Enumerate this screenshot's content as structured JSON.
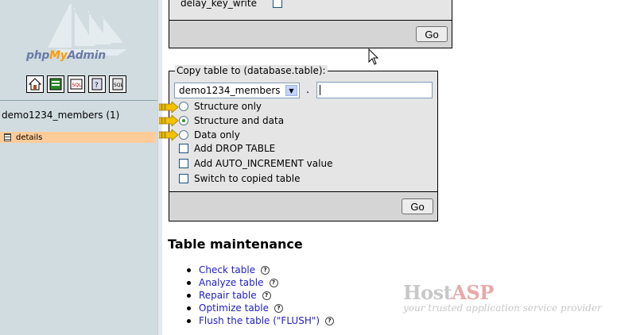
{
  "nav": {
    "logo": {
      "php": "php",
      "my": "My",
      "admin": "Admin"
    },
    "icons": [
      "home-icon",
      "query-window-icon",
      "sql-icon",
      "documentation-icon",
      "sql-docs-icon"
    ],
    "database_label": "demo1234_members (1)",
    "table_label": "details"
  },
  "top_section": {
    "checkbox_label": "delay_key_write",
    "checked": false,
    "go_label": "Go"
  },
  "copy_table": {
    "legend": "Copy table to (database.table):",
    "database_select": "demo1234_members",
    "separator": ".",
    "table_name_value": "",
    "options": [
      {
        "type": "radio",
        "label": "Structure only",
        "selected": false
      },
      {
        "type": "radio",
        "label": "Structure and data",
        "selected": true
      },
      {
        "type": "radio",
        "label": "Data only",
        "selected": false
      },
      {
        "type": "checkbox",
        "label": "Add DROP TABLE",
        "checked": false
      },
      {
        "type": "checkbox",
        "label": "Add AUTO_INCREMENT value",
        "checked": false
      },
      {
        "type": "checkbox",
        "label": "Switch to copied table",
        "checked": false
      }
    ],
    "go_label": "Go"
  },
  "maintenance": {
    "heading": "Table maintenance",
    "items": [
      {
        "label": "Check table"
      },
      {
        "label": "Analyze table"
      },
      {
        "label": "Repair table"
      },
      {
        "label": "Optimize table"
      },
      {
        "label": "Flush the table (\"FLUSH\")"
      }
    ]
  },
  "watermark": {
    "brand_host": "Host",
    "brand_asp": "ASP",
    "tagline": "your trusted application service provider"
  },
  "colors": {
    "nav_bg": "#d0dce0",
    "highlight": "#ffcc99",
    "link": "#2020c8",
    "pointer_arrow": "#f2c200"
  }
}
